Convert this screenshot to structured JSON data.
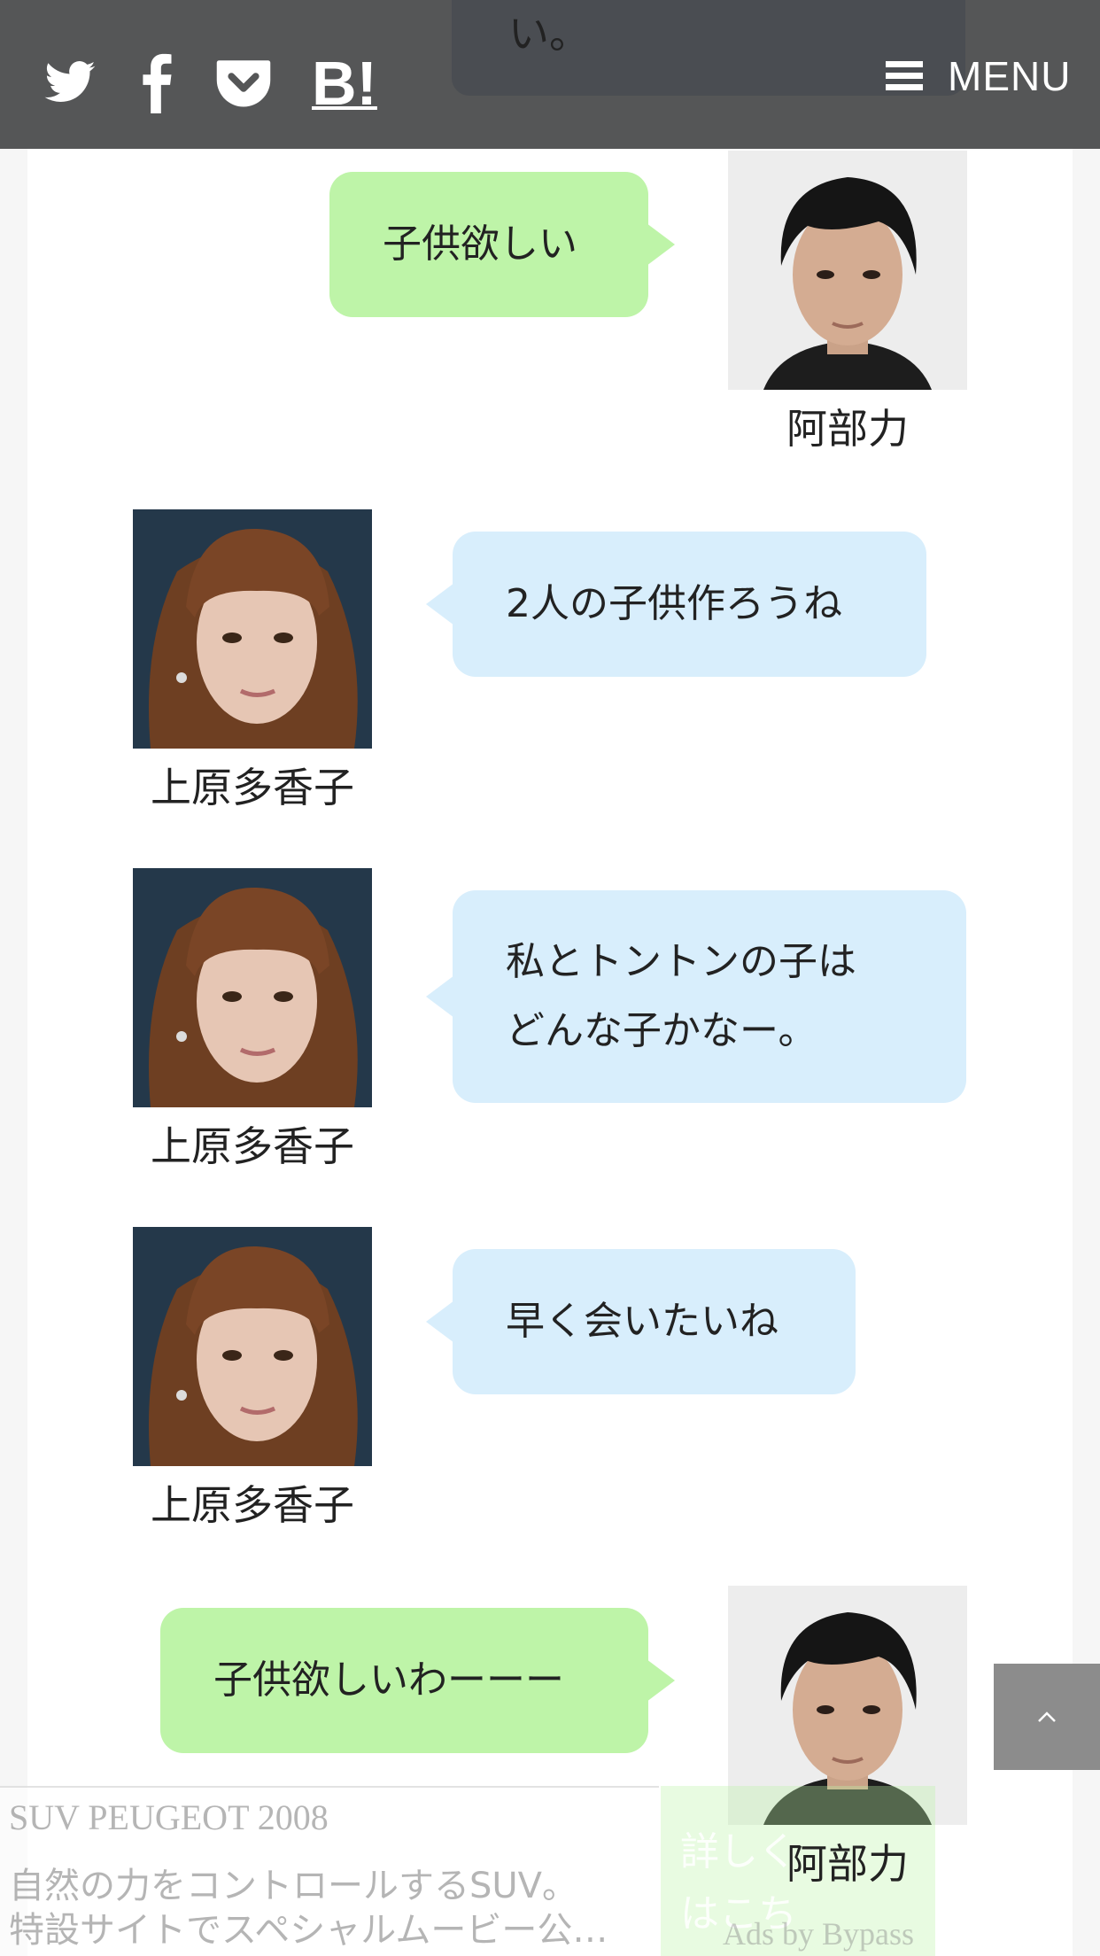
{
  "header": {
    "peek_text": "い。",
    "menu_label": "MENU",
    "share_icons": [
      "twitter-icon",
      "facebook-icon",
      "pocket-icon",
      "hatena-bookmark-icon"
    ],
    "hatena_label": "B!"
  },
  "chat": {
    "messages": [
      {
        "speaker": "阿部力",
        "text": "子供欲しい",
        "side": "right",
        "color": "#bef4a8"
      },
      {
        "speaker": "上原多香子",
        "text": "2人の子供作ろうね",
        "side": "left",
        "color": "#d8eefc"
      },
      {
        "speaker": "上原多香子",
        "text_line1": "私とトントンの子は",
        "text_line2": "どんな子かなー。",
        "side": "left",
        "color": "#d8eefc"
      },
      {
        "speaker": "上原多香子",
        "text": "早く会いたいね",
        "side": "left",
        "color": "#d8eefc"
      },
      {
        "speaker": "阿部力",
        "text": "子供欲しいわーーー",
        "side": "right",
        "color": "#bef4a8"
      }
    ]
  },
  "ad": {
    "title": "SUV PEUGEOT 2008",
    "line1": "自然の力をコントロールするSUV。",
    "line2": "特設サイトでスペシャルムービー公…",
    "cta": "詳しくはこちら",
    "credit": "Ads by Bypass"
  },
  "scroll_top": {
    "icon": "chevron-up-icon"
  }
}
